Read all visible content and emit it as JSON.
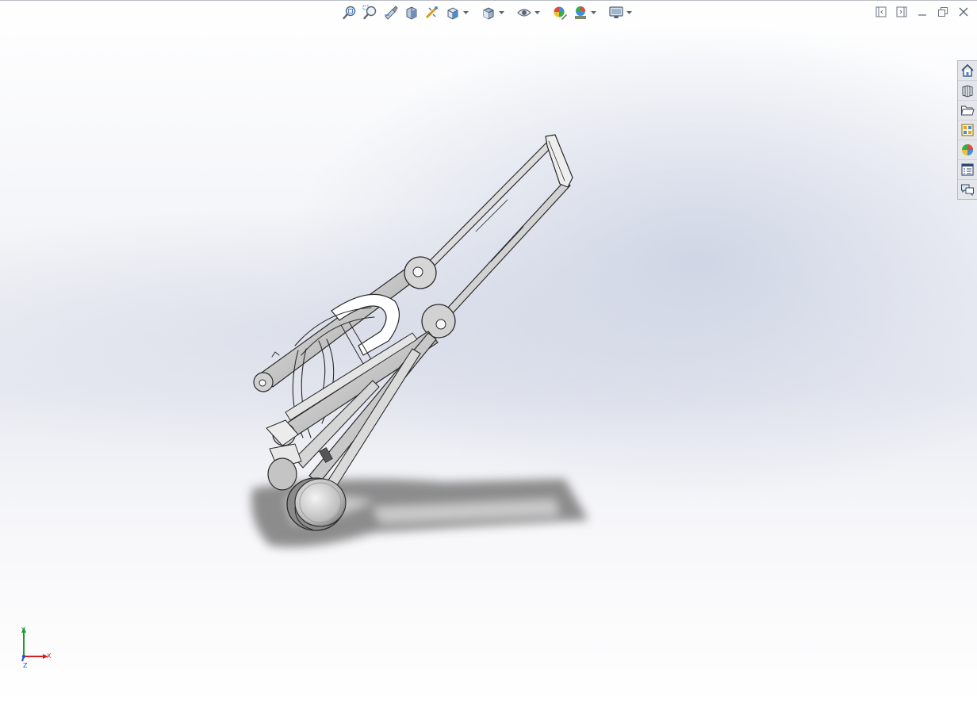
{
  "viewport": {
    "background": "#e9ebf2",
    "accent": "#4a8bd6"
  },
  "heads_up_toolbar": {
    "items": [
      {
        "name": "zoom-to-fit",
        "icon": "zoom-to-fit-icon"
      },
      {
        "name": "zoom-to-area",
        "icon": "zoom-to-area-icon"
      },
      {
        "name": "previous-view",
        "icon": "previous-view-icon"
      },
      {
        "name": "section-view",
        "icon": "section-view-icon"
      },
      {
        "name": "dynamic-annotation-views",
        "icon": "annotation-views-icon"
      },
      {
        "name": "view-orientation",
        "icon": "view-orientation-icon",
        "dropdown": true
      },
      {
        "name": "display-style",
        "icon": "display-style-icon",
        "dropdown": true
      },
      {
        "name": "hide-show-items",
        "icon": "eye-icon",
        "dropdown": true
      },
      {
        "name": "edit-appearance",
        "icon": "edit-appearance-icon"
      },
      {
        "name": "apply-scene",
        "icon": "apply-scene-icon",
        "dropdown": true
      },
      {
        "name": "view-settings",
        "icon": "monitor-icon",
        "dropdown": true
      }
    ]
  },
  "window_controls": [
    "tile-left-icon",
    "tile-right-icon",
    "minimize-icon",
    "restore-icon",
    "close-icon"
  ],
  "task_pane": {
    "tabs": [
      {
        "name": "solidworks-resources",
        "icon": "home-icon"
      },
      {
        "name": "design-library",
        "icon": "library-books-icon"
      },
      {
        "name": "file-explorer",
        "icon": "folder-icon"
      },
      {
        "name": "view-palette",
        "icon": "view-palette-icon"
      },
      {
        "name": "appearances-scenes",
        "icon": "color-sphere-icon"
      },
      {
        "name": "custom-properties",
        "icon": "properties-list-icon"
      },
      {
        "name": "forum",
        "icon": "chat-bubbles-icon"
      }
    ]
  },
  "triad": {
    "x_label": "X",
    "y_label": "Y",
    "z_label": "Z",
    "x_color": "#d42020",
    "y_color": "#1f9a2c",
    "z_color": "#2a4fd0"
  }
}
